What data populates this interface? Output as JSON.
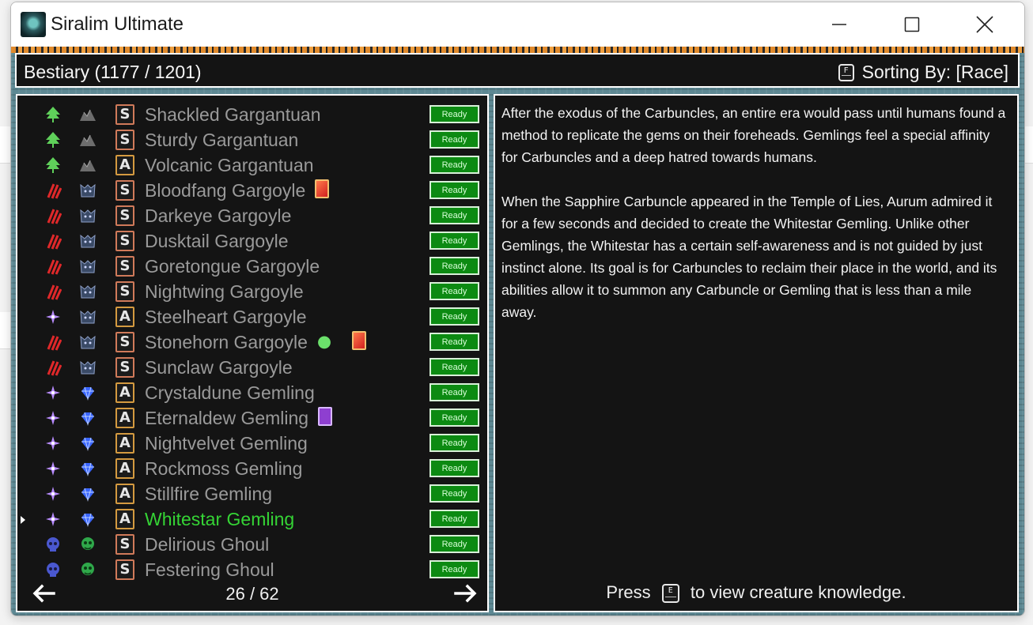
{
  "window": {
    "title": "Siralim Ultimate"
  },
  "header": {
    "title": "Bestiary (1177 / 1201)",
    "sort_key": "F",
    "sort_label": "Sorting By: [Race]"
  },
  "creatures": [
    {
      "name": "Shackled Gargantuan",
      "klass": "S",
      "element_icon": "nature-tree-icon",
      "race_icon": "gargantuan-rock-icon",
      "status": "Ready",
      "badges": []
    },
    {
      "name": "Sturdy Gargantuan",
      "klass": "S",
      "element_icon": "nature-tree-icon",
      "race_icon": "gargantuan-rock-icon",
      "status": "Ready",
      "badges": []
    },
    {
      "name": "Volcanic Gargantuan",
      "klass": "A",
      "element_icon": "nature-tree-icon",
      "race_icon": "gargantuan-rock-icon",
      "status": "Ready",
      "badges": []
    },
    {
      "name": "Bloodfang Gargoyle",
      "klass": "S",
      "element_icon": "chaos-claw-icon",
      "race_icon": "gargoyle-icon",
      "status": "Ready",
      "badges": [
        "card"
      ]
    },
    {
      "name": "Darkeye Gargoyle",
      "klass": "S",
      "element_icon": "chaos-claw-icon",
      "race_icon": "gargoyle-icon",
      "status": "Ready",
      "badges": []
    },
    {
      "name": "Dusktail Gargoyle",
      "klass": "S",
      "element_icon": "chaos-claw-icon",
      "race_icon": "gargoyle-icon",
      "status": "Ready",
      "badges": []
    },
    {
      "name": "Goretongue Gargoyle",
      "klass": "S",
      "element_icon": "chaos-claw-icon",
      "race_icon": "gargoyle-icon",
      "status": "Ready",
      "badges": []
    },
    {
      "name": "Nightwing Gargoyle",
      "klass": "S",
      "element_icon": "chaos-claw-icon",
      "race_icon": "gargoyle-icon",
      "status": "Ready",
      "badges": []
    },
    {
      "name": "Steelheart Gargoyle",
      "klass": "A",
      "element_icon": "sorcery-star-icon",
      "race_icon": "gargoyle-icon",
      "status": "Ready",
      "badges": []
    },
    {
      "name": "Stonehorn Gargoyle",
      "klass": "S",
      "element_icon": "chaos-claw-icon",
      "race_icon": "gargoyle-icon",
      "status": "Ready",
      "badges": [
        "mimic",
        "card"
      ]
    },
    {
      "name": "Sunclaw Gargoyle",
      "klass": "S",
      "element_icon": "chaos-claw-icon",
      "race_icon": "gargoyle-icon",
      "status": "Ready",
      "badges": []
    },
    {
      "name": "Crystaldune Gemling",
      "klass": "A",
      "element_icon": "sorcery-star-icon",
      "race_icon": "gemling-gem-icon",
      "status": "Ready",
      "badges": []
    },
    {
      "name": "Eternaldew Gemling",
      "klass": "A",
      "element_icon": "sorcery-star-icon",
      "race_icon": "gemling-gem-icon",
      "status": "Ready",
      "badges": [
        "spirit"
      ]
    },
    {
      "name": "Nightvelvet Gemling",
      "klass": "A",
      "element_icon": "sorcery-star-icon",
      "race_icon": "gemling-gem-icon",
      "status": "Ready",
      "badges": []
    },
    {
      "name": "Rockmoss Gemling",
      "klass": "A",
      "element_icon": "sorcery-star-icon",
      "race_icon": "gemling-gem-icon",
      "status": "Ready",
      "badges": []
    },
    {
      "name": "Stillfire Gemling",
      "klass": "A",
      "element_icon": "sorcery-star-icon",
      "race_icon": "gemling-gem-icon",
      "status": "Ready",
      "badges": []
    },
    {
      "name": "Whitestar Gemling",
      "klass": "A",
      "element_icon": "sorcery-star-icon",
      "race_icon": "gemling-gem-icon",
      "status": "Ready",
      "badges": [],
      "selected": true
    },
    {
      "name": "Delirious Ghoul",
      "klass": "S",
      "element_icon": "death-skull-icon",
      "race_icon": "ghoul-icon",
      "status": "Ready",
      "badges": []
    },
    {
      "name": "Festering Ghoul",
      "klass": "S",
      "element_icon": "death-skull-icon",
      "race_icon": "ghoul-icon",
      "status": "Ready",
      "badges": []
    }
  ],
  "pager": {
    "label": "26 / 62"
  },
  "description": {
    "paragraphs": [
      "After the exodus of the Carbuncles, an entire era would pass until humans found a method to replicate the gems on their foreheads. Gemlings feel a special affinity for Carbuncles and a deep hatred towards humans.",
      "When the Sapphire Carbuncle appeared in the Temple of Lies, Aurum admired it for a few seconds and decided to create the Whitestar Gemling. Unlike other Gemlings, the Whitestar has a certain self-awareness and is not guided by just instinct alone. Its goal is for Carbuncles to reclaim their place in the world, and its abilities allow it to summon any Carbuncle or Gemling that is less than a mile away."
    ],
    "press_prefix": "Press",
    "press_key": "E",
    "press_suffix": "to view creature knowledge."
  },
  "colors": {
    "ready_green": "#0c8a12",
    "selected_name": "#35d435",
    "name_gray": "#9a9a9a",
    "panel_bg": "#141414"
  }
}
